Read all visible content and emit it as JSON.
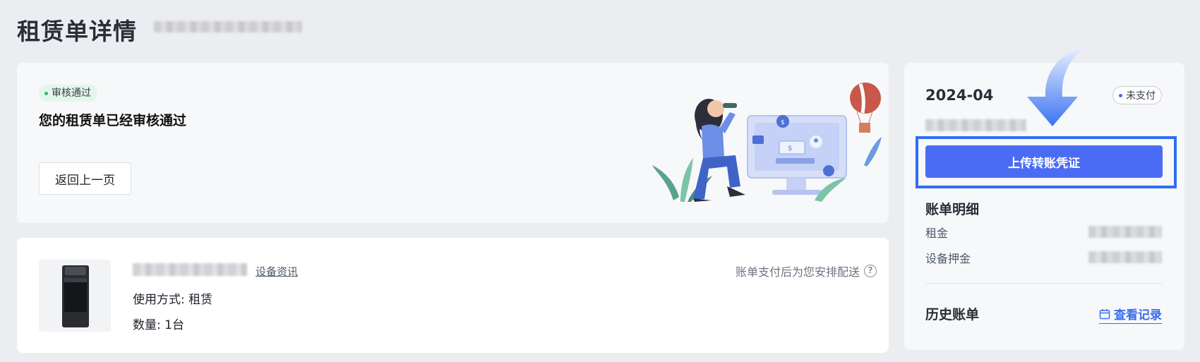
{
  "page": {
    "title": "租赁单详情"
  },
  "status": {
    "tag": "审核通过",
    "message": "您的租赁单已经审核通过",
    "back_button": "返回上一页"
  },
  "device": {
    "link": "设备资讯",
    "usage": "使用方式: 租赁",
    "quantity": "数量: 1台",
    "ship_note": "账单支付后为您安排配送",
    "help_icon": "?"
  },
  "bill": {
    "month": "2024-04",
    "status_tag": "未支付",
    "upload_button": "上传转账凭证",
    "detail_title": "账单明细",
    "rows": [
      {
        "label": "租金"
      },
      {
        "label": "设备押金"
      }
    ],
    "history_title": "历史账单",
    "history_link": "查看记录"
  },
  "colors": {
    "primary": "#4a6cf5",
    "link": "#3c6ef0",
    "highlight": "#2f6df6",
    "success_bg": "#e3f6ea",
    "success_dot": "#2fb86a"
  },
  "icons": [
    "help-circle-icon",
    "calendar-icon",
    "down-arrow-icon"
  ]
}
